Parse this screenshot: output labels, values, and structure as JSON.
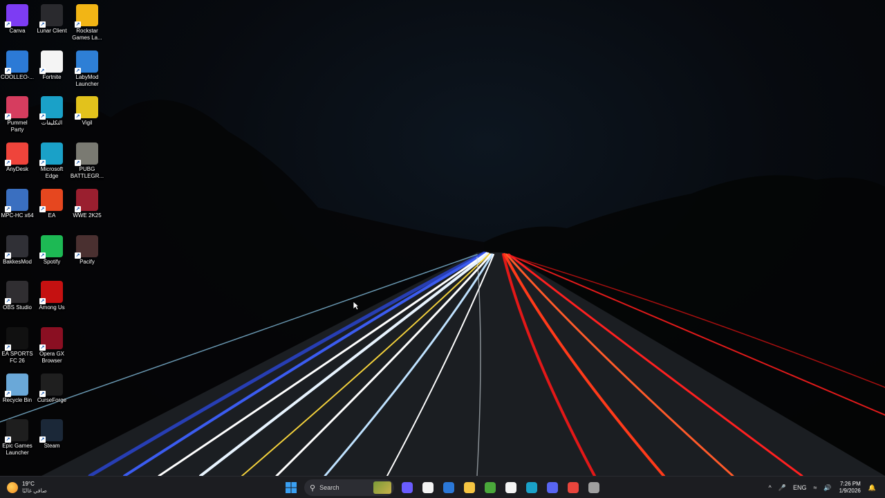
{
  "desktop": {
    "icons": [
      {
        "label": "Canva",
        "icon": "canva-icon",
        "color": "#7d3cf3"
      },
      {
        "label": "Lunar Client",
        "icon": "lunar-client-icon",
        "color": "#2a2a2e"
      },
      {
        "label": "Rockstar Games La...",
        "icon": "rockstar-icon",
        "color": "#f2b515"
      },
      {
        "label": "COOLLEO-...",
        "icon": "coolleo-icon",
        "color": "#2c7ad6"
      },
      {
        "label": "Fortnite",
        "icon": "file-icon",
        "color": "#f4f4f4"
      },
      {
        "label": "LabyMod Launcher",
        "icon": "labymod-icon",
        "color": "#2e7fd6"
      },
      {
        "label": "Pummel Party",
        "icon": "pummel-party-icon",
        "color": "#d63d5f"
      },
      {
        "label": "التكليفات",
        "icon": "edge-icon",
        "color": "#1aa1c8"
      },
      {
        "label": "Vigil",
        "icon": "vigil-icon",
        "color": "#e2c21c"
      },
      {
        "label": "AnyDesk",
        "icon": "anydesk-icon",
        "color": "#ef443b"
      },
      {
        "label": "Microsoft Edge",
        "icon": "edge-icon",
        "color": "#1aa1c8"
      },
      {
        "label": "PUBG BATTLEGR...",
        "icon": "pubg-icon",
        "color": "#7a7a72"
      },
      {
        "label": "MPC-HC x64",
        "icon": "mpc-hc-icon",
        "color": "#3a6fc0"
      },
      {
        "label": "EA",
        "icon": "ea-icon",
        "color": "#e6471f"
      },
      {
        "label": "WWE 2K25",
        "icon": "wwe-icon",
        "color": "#9a1f2f"
      },
      {
        "label": "BakkesMod",
        "icon": "bakkesmod-icon",
        "color": "#303036"
      },
      {
        "label": "Spotify",
        "icon": "spotify-icon",
        "color": "#1db954"
      },
      {
        "label": "Pacify",
        "icon": "pacify-icon",
        "color": "#4a3030"
      },
      {
        "label": "OBS Studio",
        "icon": "obs-icon",
        "color": "#302e31"
      },
      {
        "label": "Among Us",
        "icon": "among-us-icon",
        "color": "#c51111"
      },
      {
        "label": "EA SPORTS FC 26",
        "icon": "fc26-icon",
        "color": "#111111"
      },
      {
        "label": "Opera GX Browser",
        "icon": "opera-gx-icon",
        "color": "#8a0f22"
      },
      {
        "label": "Recycle Bin",
        "icon": "recycle-bin-icon",
        "color": "#6aa8d8"
      },
      {
        "label": "CurseForge",
        "icon": "curseforge-icon",
        "color": "#1f1f1f"
      },
      {
        "label": "Epic Games Launcher",
        "icon": "epic-games-icon",
        "color": "#1e1e1e"
      },
      {
        "label": "Steam",
        "icon": "steam-icon",
        "color": "#1b2838"
      }
    ]
  },
  "taskbar": {
    "weather": {
      "temp": "19°C",
      "condition": "صافي غالبًا"
    },
    "search_placeholder": "Search",
    "pinned": [
      {
        "icon": "copilot-icon",
        "color": "#6a5cff"
      },
      {
        "icon": "microsoft-store-icon",
        "color": "#f3f3f3"
      },
      {
        "icon": "defender-icon",
        "color": "#2b78d8"
      },
      {
        "icon": "file-explorer-icon",
        "color": "#f5c542"
      },
      {
        "icon": "minecraft-icon",
        "color": "#4aa83a"
      },
      {
        "icon": "document-icon",
        "color": "#f4f4f4"
      },
      {
        "icon": "edge-icon",
        "color": "#1aa1c8"
      },
      {
        "icon": "discord-icon",
        "color": "#5865f2"
      },
      {
        "icon": "chrome-icon",
        "color": "#e8453c"
      },
      {
        "icon": "generic-app-icon",
        "color": "#a0a0a0"
      }
    ],
    "tray": {
      "language": "ENG",
      "time": "7:26 PM",
      "date": "1/9/2026"
    }
  }
}
